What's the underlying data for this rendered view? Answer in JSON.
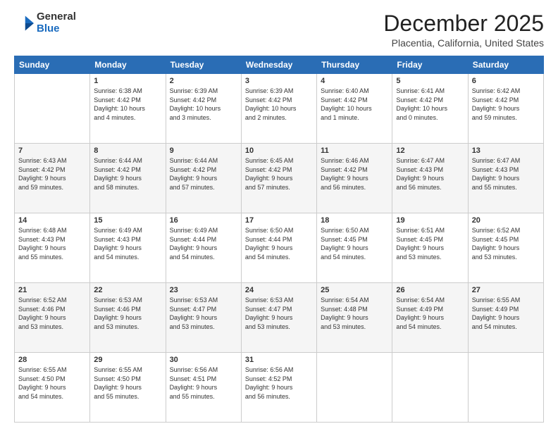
{
  "logo": {
    "general": "General",
    "blue": "Blue"
  },
  "header": {
    "month": "December 2025",
    "location": "Placentia, California, United States"
  },
  "days_of_week": [
    "Sunday",
    "Monday",
    "Tuesday",
    "Wednesday",
    "Thursday",
    "Friday",
    "Saturday"
  ],
  "weeks": [
    [
      {
        "day": "",
        "info": ""
      },
      {
        "day": "1",
        "info": "Sunrise: 6:38 AM\nSunset: 4:42 PM\nDaylight: 10 hours\nand 4 minutes."
      },
      {
        "day": "2",
        "info": "Sunrise: 6:39 AM\nSunset: 4:42 PM\nDaylight: 10 hours\nand 3 minutes."
      },
      {
        "day": "3",
        "info": "Sunrise: 6:39 AM\nSunset: 4:42 PM\nDaylight: 10 hours\nand 2 minutes."
      },
      {
        "day": "4",
        "info": "Sunrise: 6:40 AM\nSunset: 4:42 PM\nDaylight: 10 hours\nand 1 minute."
      },
      {
        "day": "5",
        "info": "Sunrise: 6:41 AM\nSunset: 4:42 PM\nDaylight: 10 hours\nand 0 minutes."
      },
      {
        "day": "6",
        "info": "Sunrise: 6:42 AM\nSunset: 4:42 PM\nDaylight: 9 hours\nand 59 minutes."
      }
    ],
    [
      {
        "day": "7",
        "info": "Sunrise: 6:43 AM\nSunset: 4:42 PM\nDaylight: 9 hours\nand 59 minutes."
      },
      {
        "day": "8",
        "info": "Sunrise: 6:44 AM\nSunset: 4:42 PM\nDaylight: 9 hours\nand 58 minutes."
      },
      {
        "day": "9",
        "info": "Sunrise: 6:44 AM\nSunset: 4:42 PM\nDaylight: 9 hours\nand 57 minutes."
      },
      {
        "day": "10",
        "info": "Sunrise: 6:45 AM\nSunset: 4:42 PM\nDaylight: 9 hours\nand 57 minutes."
      },
      {
        "day": "11",
        "info": "Sunrise: 6:46 AM\nSunset: 4:42 PM\nDaylight: 9 hours\nand 56 minutes."
      },
      {
        "day": "12",
        "info": "Sunrise: 6:47 AM\nSunset: 4:43 PM\nDaylight: 9 hours\nand 56 minutes."
      },
      {
        "day": "13",
        "info": "Sunrise: 6:47 AM\nSunset: 4:43 PM\nDaylight: 9 hours\nand 55 minutes."
      }
    ],
    [
      {
        "day": "14",
        "info": "Sunrise: 6:48 AM\nSunset: 4:43 PM\nDaylight: 9 hours\nand 55 minutes."
      },
      {
        "day": "15",
        "info": "Sunrise: 6:49 AM\nSunset: 4:43 PM\nDaylight: 9 hours\nand 54 minutes."
      },
      {
        "day": "16",
        "info": "Sunrise: 6:49 AM\nSunset: 4:44 PM\nDaylight: 9 hours\nand 54 minutes."
      },
      {
        "day": "17",
        "info": "Sunrise: 6:50 AM\nSunset: 4:44 PM\nDaylight: 9 hours\nand 54 minutes."
      },
      {
        "day": "18",
        "info": "Sunrise: 6:50 AM\nSunset: 4:45 PM\nDaylight: 9 hours\nand 54 minutes."
      },
      {
        "day": "19",
        "info": "Sunrise: 6:51 AM\nSunset: 4:45 PM\nDaylight: 9 hours\nand 53 minutes."
      },
      {
        "day": "20",
        "info": "Sunrise: 6:52 AM\nSunset: 4:45 PM\nDaylight: 9 hours\nand 53 minutes."
      }
    ],
    [
      {
        "day": "21",
        "info": "Sunrise: 6:52 AM\nSunset: 4:46 PM\nDaylight: 9 hours\nand 53 minutes."
      },
      {
        "day": "22",
        "info": "Sunrise: 6:53 AM\nSunset: 4:46 PM\nDaylight: 9 hours\nand 53 minutes."
      },
      {
        "day": "23",
        "info": "Sunrise: 6:53 AM\nSunset: 4:47 PM\nDaylight: 9 hours\nand 53 minutes."
      },
      {
        "day": "24",
        "info": "Sunrise: 6:53 AM\nSunset: 4:47 PM\nDaylight: 9 hours\nand 53 minutes."
      },
      {
        "day": "25",
        "info": "Sunrise: 6:54 AM\nSunset: 4:48 PM\nDaylight: 9 hours\nand 53 minutes."
      },
      {
        "day": "26",
        "info": "Sunrise: 6:54 AM\nSunset: 4:49 PM\nDaylight: 9 hours\nand 54 minutes."
      },
      {
        "day": "27",
        "info": "Sunrise: 6:55 AM\nSunset: 4:49 PM\nDaylight: 9 hours\nand 54 minutes."
      }
    ],
    [
      {
        "day": "28",
        "info": "Sunrise: 6:55 AM\nSunset: 4:50 PM\nDaylight: 9 hours\nand 54 minutes."
      },
      {
        "day": "29",
        "info": "Sunrise: 6:55 AM\nSunset: 4:50 PM\nDaylight: 9 hours\nand 55 minutes."
      },
      {
        "day": "30",
        "info": "Sunrise: 6:56 AM\nSunset: 4:51 PM\nDaylight: 9 hours\nand 55 minutes."
      },
      {
        "day": "31",
        "info": "Sunrise: 6:56 AM\nSunset: 4:52 PM\nDaylight: 9 hours\nand 56 minutes."
      },
      {
        "day": "",
        "info": ""
      },
      {
        "day": "",
        "info": ""
      },
      {
        "day": "",
        "info": ""
      }
    ]
  ]
}
